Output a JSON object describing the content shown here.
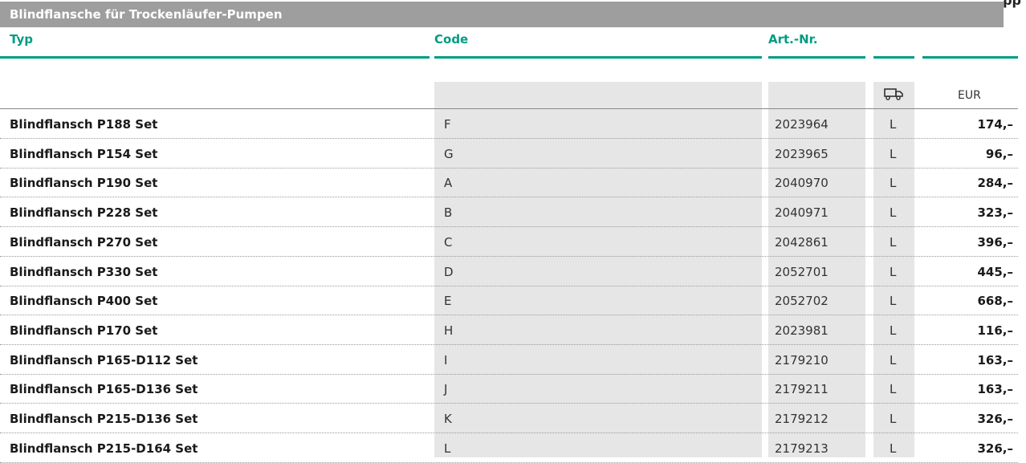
{
  "corner_glyph": "ρρ",
  "table": {
    "title": "Blindflansche für Trockenläufer-Pumpen",
    "headers": {
      "typ": "Typ",
      "code": "Code",
      "art_nr": "Art.-Nr."
    },
    "subheaders": {
      "truck_icon": "truck-icon",
      "currency": "EUR"
    },
    "colors": {
      "accent": "#009c82",
      "title_bar": "#9e9e9e",
      "shaded_column": "#e6e6e6"
    },
    "rows": [
      {
        "typ": "Blindflansch P188 Set",
        "code": "F",
        "art_nr": "2023964",
        "availability": "L",
        "price": "174,–"
      },
      {
        "typ": "Blindflansch P154 Set",
        "code": "G",
        "art_nr": "2023965",
        "availability": "L",
        "price": "96,–"
      },
      {
        "typ": "Blindflansch P190 Set",
        "code": "A",
        "art_nr": "2040970",
        "availability": "L",
        "price": "284,–"
      },
      {
        "typ": "Blindflansch P228 Set",
        "code": "B",
        "art_nr": "2040971",
        "availability": "L",
        "price": "323,–"
      },
      {
        "typ": "Blindflansch P270 Set",
        "code": "C",
        "art_nr": "2042861",
        "availability": "L",
        "price": "396,–"
      },
      {
        "typ": "Blindflansch P330 Set",
        "code": "D",
        "art_nr": "2052701",
        "availability": "L",
        "price": "445,–"
      },
      {
        "typ": "Blindflansch P400 Set",
        "code": "E",
        "art_nr": "2052702",
        "availability": "L",
        "price": "668,–"
      },
      {
        "typ": "Blindflansch P170 Set",
        "code": "H",
        "art_nr": "2023981",
        "availability": "L",
        "price": "116,–"
      },
      {
        "typ": "Blindflansch P165-D112 Set",
        "code": "I",
        "art_nr": "2179210",
        "availability": "L",
        "price": "163,–"
      },
      {
        "typ": "Blindflansch P165-D136 Set",
        "code": "J",
        "art_nr": "2179211",
        "availability": "L",
        "price": "163,–"
      },
      {
        "typ": "Blindflansch P215-D136 Set",
        "code": "K",
        "art_nr": "2179212",
        "availability": "L",
        "price": "326,–"
      },
      {
        "typ": "Blindflansch P215-D164 Set",
        "code": "L",
        "art_nr": "2179213",
        "availability": "L",
        "price": "326,–"
      }
    ]
  }
}
